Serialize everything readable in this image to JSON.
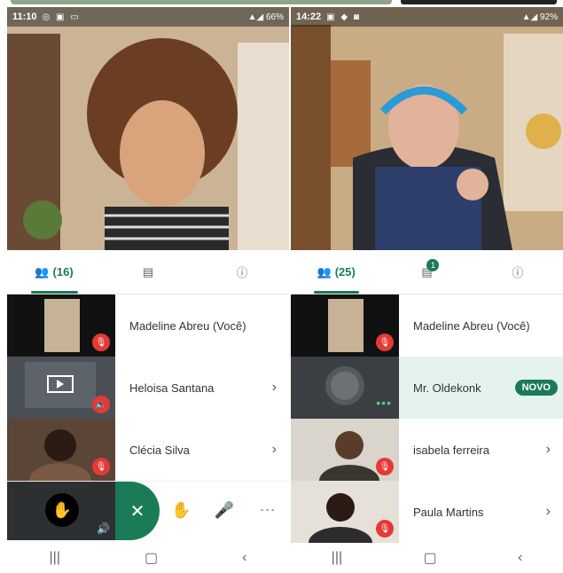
{
  "left": {
    "status": {
      "time": "11:10",
      "battery": "66%"
    },
    "tabs": {
      "participants_count": "(16)"
    },
    "participants": [
      {
        "name": "Madeline Abreu (Você)"
      },
      {
        "name": "Heloisa Santana"
      },
      {
        "name": "Clécia Silva"
      }
    ],
    "controls": {
      "close": "✕"
    }
  },
  "right": {
    "status": {
      "time": "14:22",
      "battery": "92%"
    },
    "tabs": {
      "participants_count": "(25)",
      "chat_badge": "1"
    },
    "participants": [
      {
        "name": "Madeline Abreu (Você)"
      },
      {
        "name": "Mr. Oldekonk",
        "badge": "NOVO"
      },
      {
        "name": "isabela ferreira"
      },
      {
        "name": "Paula Martins"
      }
    ]
  },
  "colors": {
    "accent": "#1c7b57",
    "mic_muted": "#e53935",
    "highlight": "#e4f3ef"
  }
}
